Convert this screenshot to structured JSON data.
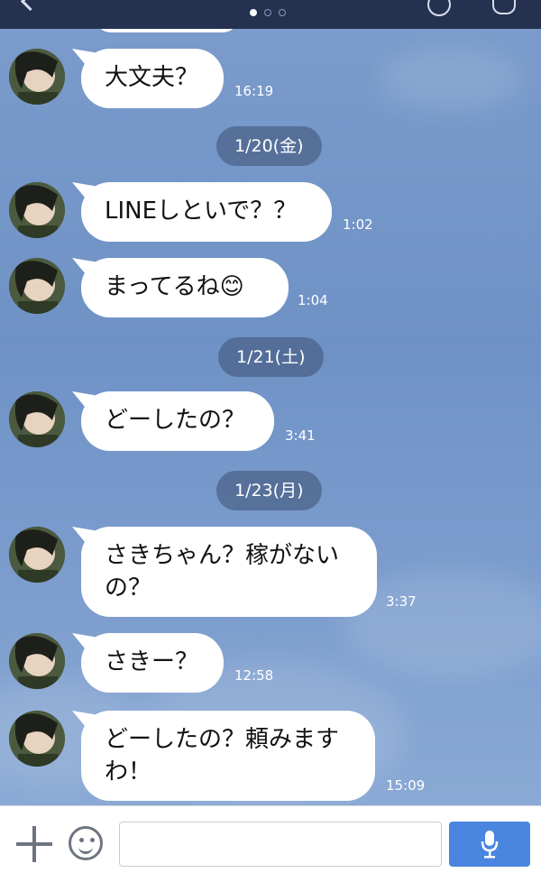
{
  "header": {
    "page_indicator": {
      "count": 3,
      "active": 0
    }
  },
  "messages": [
    {
      "text": "大文夫？",
      "time": "16:19"
    },
    {
      "date": "1/20(金)"
    },
    {
      "text": "LINEしといで？？",
      "time": "1:02"
    },
    {
      "text": "まってるね😊",
      "time": "1:04"
    },
    {
      "date": "1/21(土)"
    },
    {
      "text": "どーしたの？",
      "time": "3:41"
    },
    {
      "date": "1/23(月)"
    },
    {
      "text": "さきちゃん？稼がないの？",
      "time": "3:37"
    },
    {
      "text": "さきー？",
      "time": "12:58"
    },
    {
      "text": "どーしたの？頼みますわ！",
      "time": "15:09"
    }
  ],
  "input": {
    "value": "",
    "placeholder": ""
  },
  "icons": {
    "add": "plus-icon",
    "emoji": "emoji-icon",
    "mic": "microphone-icon"
  },
  "colors": {
    "header": "#24324f",
    "chat_background": "#7496c8",
    "bubble": "#ffffff",
    "send_button": "#4a86df"
  }
}
